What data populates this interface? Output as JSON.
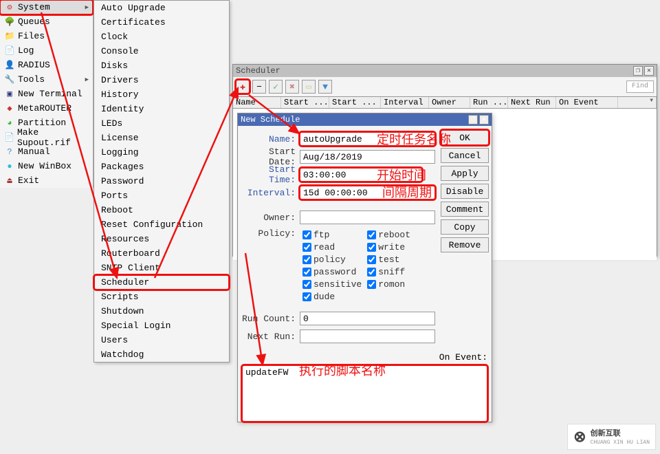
{
  "left_nav": {
    "items": [
      {
        "icon": "⚙",
        "label": "System",
        "has_children": true,
        "highlighted": true,
        "icon_color": "#c44"
      },
      {
        "icon": "🌳",
        "label": "Queues",
        "icon_color": "#2a2"
      },
      {
        "icon": "📁",
        "label": "Files",
        "icon_color": "#49d"
      },
      {
        "icon": "📄",
        "label": "Log",
        "icon_color": "#888"
      },
      {
        "icon": "👤",
        "label": "RADIUS",
        "icon_color": "#8a4"
      },
      {
        "icon": "🔧",
        "label": "Tools",
        "has_children": true,
        "icon_color": "#888"
      },
      {
        "icon": "▣",
        "label": "New Terminal",
        "icon_color": "#237"
      },
      {
        "icon": "◆",
        "label": "MetaROUTER",
        "icon_color": "#c33"
      },
      {
        "icon": "◕",
        "label": "Partition",
        "icon_color": "#3b3"
      },
      {
        "icon": "📄",
        "label": "Make Supout.rif",
        "icon_color": "#888"
      },
      {
        "icon": "?",
        "label": "Manual",
        "icon_color": "#48c"
      },
      {
        "icon": "●",
        "label": "New WinBox",
        "icon_color": "#3bd"
      },
      {
        "icon": "⏏",
        "label": "Exit",
        "icon_color": "#a33"
      }
    ]
  },
  "system_submenu": [
    "Auto Upgrade",
    "Certificates",
    "Clock",
    "Console",
    "Disks",
    "Drivers",
    "History",
    "Identity",
    "LEDs",
    "License",
    "Logging",
    "Packages",
    "Password",
    "Ports",
    "Reboot",
    "Reset Configuration",
    "Resources",
    "Routerboard",
    "SNTP Client",
    "Scheduler",
    "Scripts",
    "Shutdown",
    "Special Login",
    "Users",
    "Watchdog"
  ],
  "scheduler_highlight_index": 19,
  "scheduler_win": {
    "title": "Scheduler",
    "find": "Find",
    "columns": [
      "Name",
      "Start ...",
      "Start ...",
      "Interval",
      "Owner",
      "Run ...",
      "Next Run",
      "On Event"
    ]
  },
  "new_sched": {
    "title": "New Schedule",
    "labels": {
      "name": "Name:",
      "start_date": "Start Date:",
      "start_time": "Start Time:",
      "interval": "Interval:",
      "owner": "Owner:",
      "policy": "Policy:",
      "run_count": "Run Count:",
      "next_run": "Next Run:",
      "on_event": "On Event:"
    },
    "values": {
      "name": "autoUpgrade",
      "start_date": "Aug/18/2019",
      "start_time": "03:00:00",
      "interval": "15d 00:00:00",
      "owner": "",
      "run_count": "0",
      "next_run": "",
      "on_event": "updateFW"
    },
    "policy": [
      {
        "label": "ftp",
        "checked": true
      },
      {
        "label": "reboot",
        "checked": true
      },
      {
        "label": "read",
        "checked": true
      },
      {
        "label": "write",
        "checked": true
      },
      {
        "label": "policy",
        "checked": true
      },
      {
        "label": "test",
        "checked": true
      },
      {
        "label": "password",
        "checked": true
      },
      {
        "label": "sniff",
        "checked": true
      },
      {
        "label": "sensitive",
        "checked": true
      },
      {
        "label": "romon",
        "checked": true
      },
      {
        "label": "dude",
        "checked": true
      }
    ],
    "buttons": {
      "ok": "OK",
      "cancel": "Cancel",
      "apply": "Apply",
      "disable": "Disable",
      "comment": "Comment",
      "copy": "Copy",
      "remove": "Remove"
    }
  },
  "annotations": {
    "task_name": "定时任务名称",
    "start_time": "开始时间",
    "interval": "间隔周期",
    "script": "执行的脚本名称"
  },
  "logo": {
    "brand": "创新互联",
    "sub": "CHUANG XIN HU LIAN"
  }
}
